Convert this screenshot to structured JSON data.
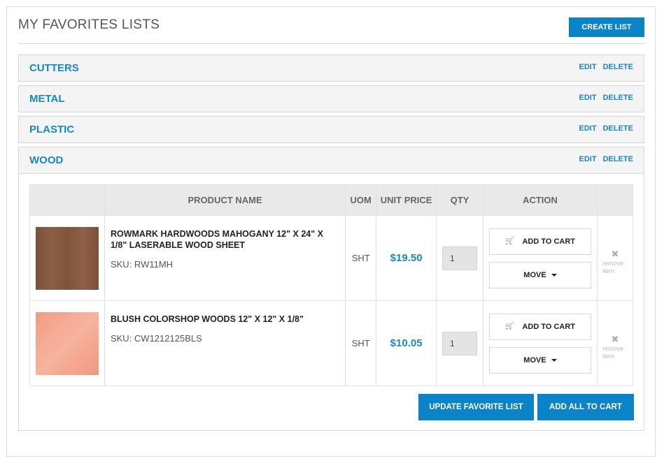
{
  "page": {
    "title": "MY FAVORITES LISTS",
    "create_button": "CREATE LIST"
  },
  "lists": [
    {
      "name": "CUTTERS",
      "edit": "EDIT",
      "delete": "DELETE",
      "expanded": false
    },
    {
      "name": "METAL",
      "edit": "EDIT",
      "delete": "DELETE",
      "expanded": false
    },
    {
      "name": "PLASTIC",
      "edit": "EDIT",
      "delete": "DELETE",
      "expanded": false
    },
    {
      "name": "WOOD",
      "edit": "EDIT",
      "delete": "DELETE",
      "expanded": true
    }
  ],
  "table": {
    "headers": {
      "product_name": "PRODUCT NAME",
      "uom": "UOM",
      "unit_price": "UNIT PRICE",
      "qty": "QTY",
      "action": "ACTION"
    },
    "rows": [
      {
        "name": "ROWMARK HARDWOODS MAHOGANY 12\" X 24\" X 1/8\" LASERABLE WOOD SHEET",
        "sku": "SKU: RW11MH",
        "uom": "SHT",
        "price": "$19.50",
        "qty": "1",
        "add_to_cart": "ADD TO CART",
        "move": "MOVE",
        "remove": "remove item",
        "swatch_color": "#845840"
      },
      {
        "name": "BLUSH COLORSHOP WOODS 12\" X 12\" X 1/8\"",
        "sku": "SKU: CW1212125BLS",
        "uom": "SHT",
        "price": "$10.05",
        "qty": "1",
        "add_to_cart": "ADD TO CART",
        "move": "MOVE",
        "remove": "remove item",
        "swatch_color": "#f4a88f"
      }
    ]
  },
  "footer": {
    "update_button": "UPDATE FAVORITE LIST",
    "add_all_button": "ADD ALL TO CART"
  },
  "colors": {
    "accent": "#0a84c6",
    "link": "#1a86c4"
  }
}
